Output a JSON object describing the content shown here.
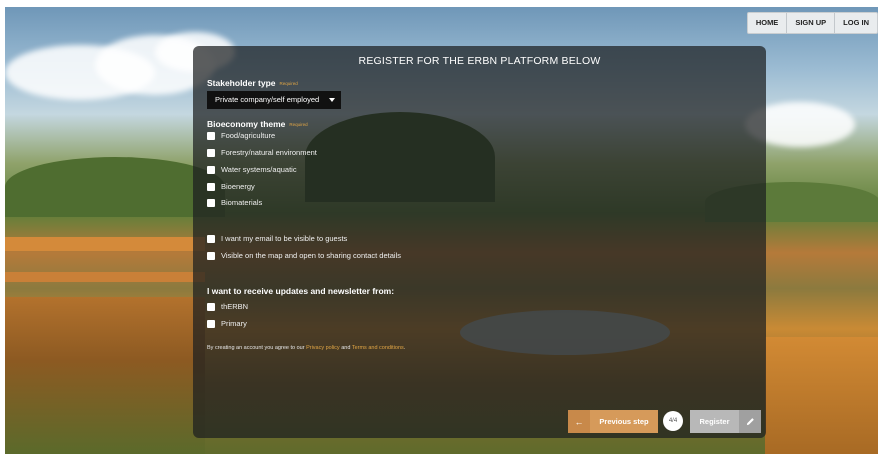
{
  "nav": {
    "home": "HOME",
    "signup": "SIGN UP",
    "login": "LOG IN"
  },
  "form": {
    "title": "REGISTER FOR THE ERBN PLATFORM BELOW",
    "stakeholder_label": "Stakeholder type",
    "required": "Required",
    "stakeholder_value": "Private company/self employed",
    "theme_label": "Bioeconomy theme",
    "themes": [
      "Food/agriculture",
      "Forestry/natural environment",
      "Water systems/aquatic",
      "Bioenergy",
      "Biomaterials"
    ],
    "privacy_options": [
      "I want my email to be visible to guests",
      "Visible on the map and open to sharing contact details"
    ],
    "updates_label": "I want to receive updates and newsletter from:",
    "updates": [
      "thERBN",
      "Primary"
    ],
    "terms_prefix": "By creating an account you agree to our ",
    "privacy_link": "Privacy policy",
    "terms_and": " and ",
    "terms_link": "Terms and conditions",
    "terms_suffix": "."
  },
  "actions": {
    "prev_label": "Previous step",
    "step": "4/4",
    "register_label": "Register"
  },
  "colors": {
    "accent": "#d69a5a",
    "required": "#e0a545",
    "panel": "#1c1e20"
  },
  "icons": {
    "prev": "arrow-left-icon",
    "register": "pencil-icon"
  }
}
